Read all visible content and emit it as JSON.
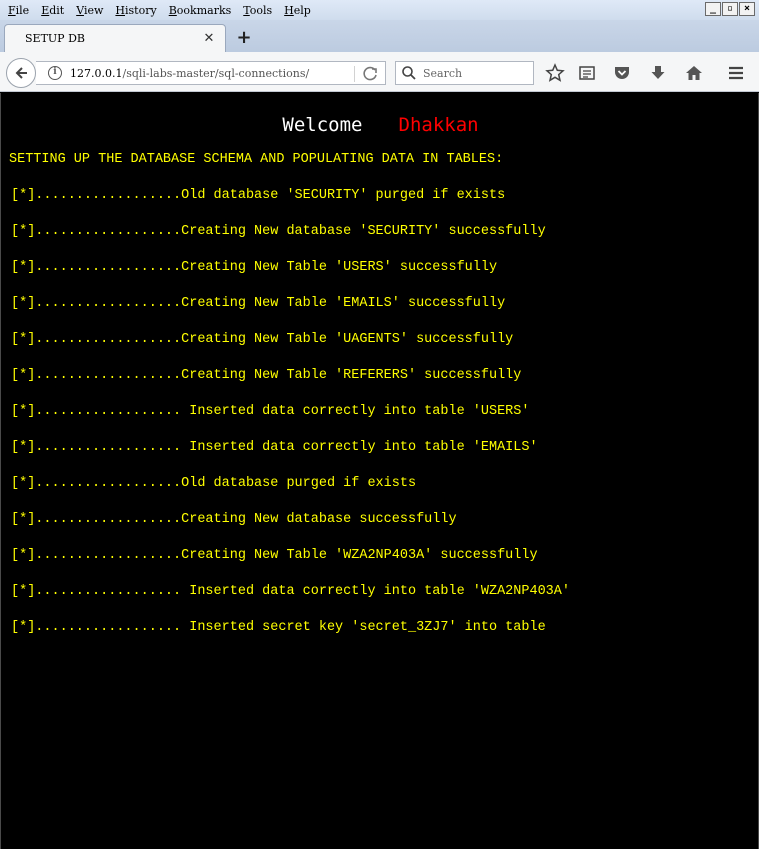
{
  "menubar": {
    "items": [
      "File",
      "Edit",
      "View",
      "History",
      "Bookmarks",
      "Tools",
      "Help"
    ]
  },
  "tab": {
    "title": "SETUP DB"
  },
  "navbar": {
    "url_host": "127.0.0.1",
    "url_path": "/sqli-labs-master/sql-connections/",
    "search_placeholder": "Search"
  },
  "content": {
    "welcome_word": "Welcome",
    "welcome_name": "Dhakkan",
    "heading": "SETTING UP THE DATABASE SCHEMA AND POPULATING DATA IN TABLES:",
    "log_lines": [
      "[*]..................Old database 'SECURITY' purged if exists",
      "[*]..................Creating New database 'SECURITY' successfully",
      "[*]..................Creating New Table 'USERS' successfully",
      "[*]..................Creating New Table 'EMAILS' successfully",
      "[*]..................Creating New Table 'UAGENTS' successfully",
      "[*]..................Creating New Table 'REFERERS' successfully",
      "[*].................. Inserted data correctly into table 'USERS'",
      "[*].................. Inserted data correctly into table 'EMAILS'",
      "[*]..................Old database purged if exists",
      "[*]..................Creating New database successfully",
      "[*]..................Creating New Table 'WZA2NP403A' successfully",
      "[*].................. Inserted data correctly into table 'WZA2NP403A'",
      "[*].................. Inserted secret key 'secret_3ZJ7' into table"
    ]
  },
  "colors": {
    "log_text": "#ffff00",
    "welcome_word": "#ffffff",
    "welcome_name": "#ff0000",
    "page_background": "#000000"
  }
}
